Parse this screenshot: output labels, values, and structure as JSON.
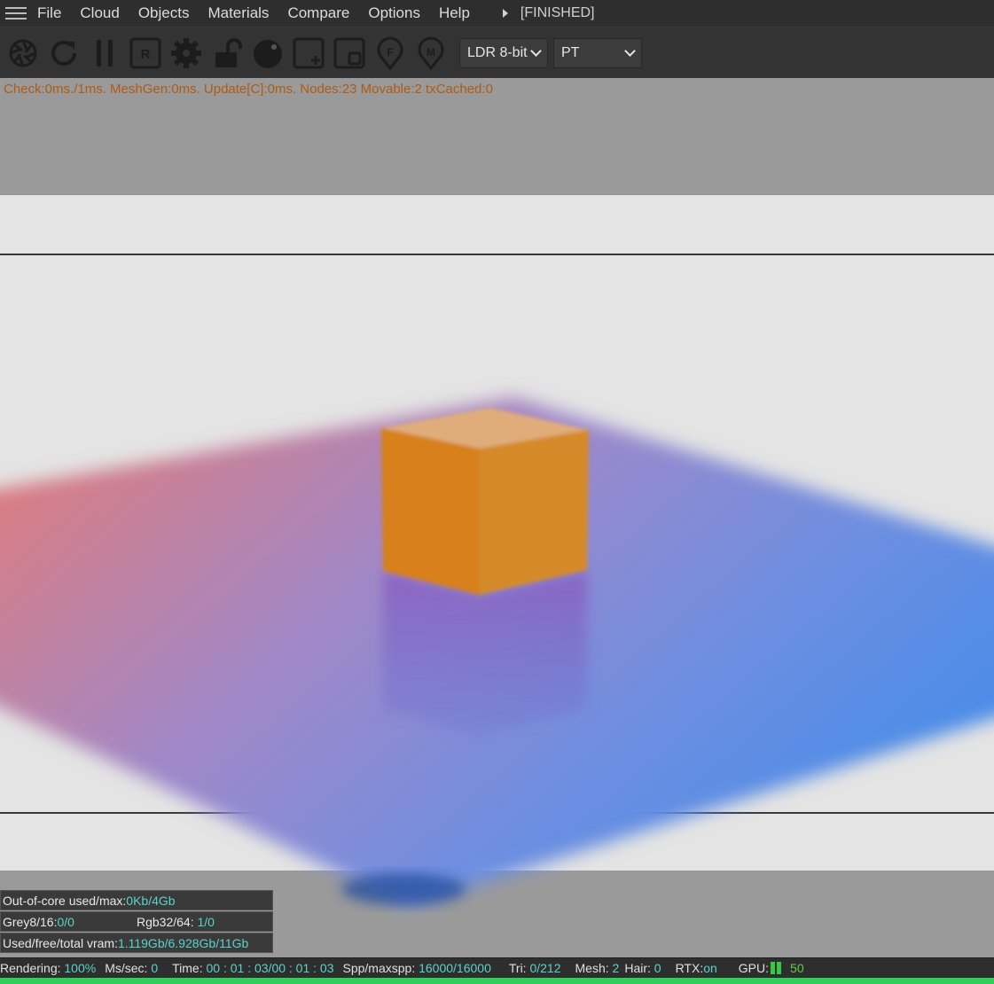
{
  "menu": {
    "items": [
      "File",
      "Cloud",
      "Objects",
      "Materials",
      "Compare",
      "Options",
      "Help"
    ],
    "status": "[FINISHED]"
  },
  "toolbar": {
    "icons": [
      "aperture-icon",
      "reload-icon",
      "pause-icon",
      "r-box-icon",
      "gear-icon",
      "unlock-icon",
      "sphere-icon",
      "region-add-icon",
      "region-icon",
      "focus-pin-icon",
      "material-pin-icon"
    ],
    "display_mode": "LDR 8-bit",
    "kernel": "PT"
  },
  "viewport": {
    "stats_line": "Check:0ms./1ms. MeshGen:0ms. Update[C]:0ms. Nodes:23 Movable:2 txCached:0"
  },
  "overlay": {
    "ooc_label": "Out-of-core used/max:",
    "ooc_value": "0Kb/4Gb",
    "grey_label": "Grey8/16: ",
    "grey_value": "0/0",
    "rgb_label": "Rgb32/64: ",
    "rgb_value": "1/0",
    "vram_label": "Used/free/total vram: ",
    "vram_value": "1.119Gb/6.928Gb/11Gb"
  },
  "statusbar": {
    "rendering_label": "Rendering:",
    "rendering_value": "100%",
    "mspersec_label": "Ms/sec:",
    "mspersec_value": "0",
    "time_label": "Time:",
    "time_value": "00 : 01 : 03/00 : 01 : 03",
    "spp_label": "Spp/maxspp:",
    "spp_value": "16000/16000",
    "tri_label": "Tri:",
    "tri_value": "0/212",
    "mesh_label": "Mesh:",
    "mesh_value": "2",
    "hair_label": "Hair:",
    "hair_value": "0",
    "rtx_label": "RTX:",
    "rtx_value": "on",
    "gpu_label": "GPU:",
    "gpu_value": "50"
  },
  "progress": 1.0,
  "colors": {
    "accent_teal": "#58d4c8",
    "stats_orange": "#b05a12",
    "progress_green": "#2fd05a",
    "cube_orange": "#d8841c"
  }
}
